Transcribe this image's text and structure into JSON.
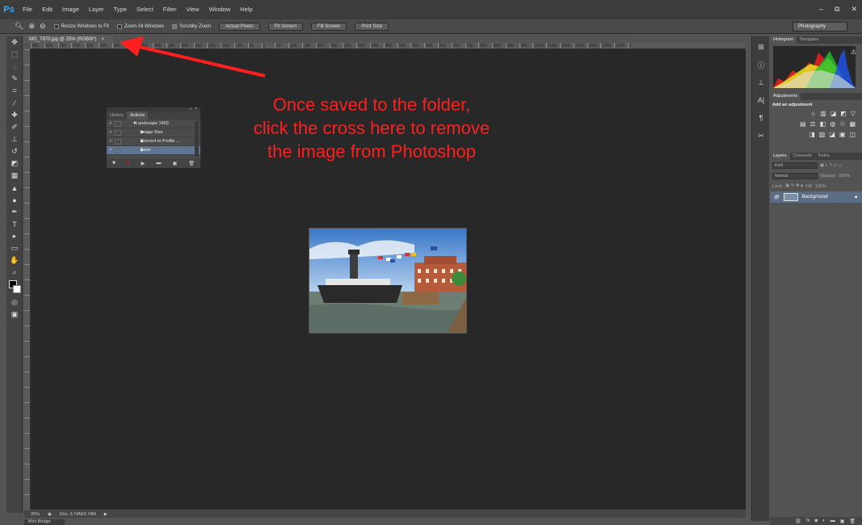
{
  "app": {
    "logo": "Ps"
  },
  "menu": [
    "File",
    "Edit",
    "Image",
    "Layer",
    "Type",
    "Select",
    "Filter",
    "View",
    "Window",
    "Help"
  ],
  "window_controls": {
    "minimize": "–",
    "restore": "⧉",
    "close": "✕"
  },
  "options_bar": {
    "resize_windows": "Resize Windows to Fit",
    "zoom_all": "Zoom All Windows",
    "scrubby": "Scrubby Zoom",
    "buttons": [
      "Actual Pixels",
      "Fit Screen",
      "Fill Screen",
      "Print Size"
    ]
  },
  "workspace": "Photography",
  "document": {
    "tab": "MG_7870.jpg @ 25% (RGB/8*)",
    "close": "×"
  },
  "ruler_ticks": [
    "850",
    "800",
    "750",
    "700",
    "650",
    "600",
    "550",
    "500",
    "450",
    "400",
    "350",
    "300",
    "250",
    "200",
    "150",
    "100",
    "50",
    "0",
    "50",
    "100",
    "150",
    "200",
    "250",
    "300",
    "350",
    "400",
    "450",
    "500",
    "550",
    "600",
    "650",
    "700",
    "750",
    "800",
    "850",
    "900",
    "950",
    "1000",
    "1050",
    "1100",
    "1150",
    "1200",
    "1250",
    "1300",
    "1"
  ],
  "status": {
    "zoom": "25%",
    "doc": "Doc: 3.74M/3.74M"
  },
  "mini_bridge": "Mini Bridge",
  "histogram": {
    "tabs": [
      "Histogram",
      "Navigator"
    ]
  },
  "adjustments": {
    "tab": "Adjustments",
    "title": "Add an adjustment"
  },
  "layers": {
    "tabs": [
      "Layers",
      "Channels",
      "Paths"
    ],
    "kind": "Kind",
    "blend": "Normal",
    "opacity_label": "Opacity:",
    "opacity": "100%",
    "lock_label": "Lock:",
    "fill_label": "Fill:",
    "fill": "100%",
    "layer_name": "Background"
  },
  "actions": {
    "tabs": [
      "History",
      "Actions"
    ],
    "items": [
      {
        "label": "Landscape 1400",
        "indent": 0,
        "caret": "▼"
      },
      {
        "label": "Image Size",
        "indent": 1,
        "caret": "▶"
      },
      {
        "label": "Convert to Profile ...",
        "indent": 1,
        "caret": "▶"
      },
      {
        "label": "Save",
        "indent": 1,
        "caret": "▶"
      }
    ]
  },
  "annotation": {
    "line1": "Once saved to the folder,",
    "line2": "click the cross here to remove",
    "line3": "the image from Photoshop",
    "color": "#ff1f1f"
  },
  "colors": {
    "canvas": "#282828",
    "chrome": "#535353",
    "accent": "#31a8ff"
  }
}
